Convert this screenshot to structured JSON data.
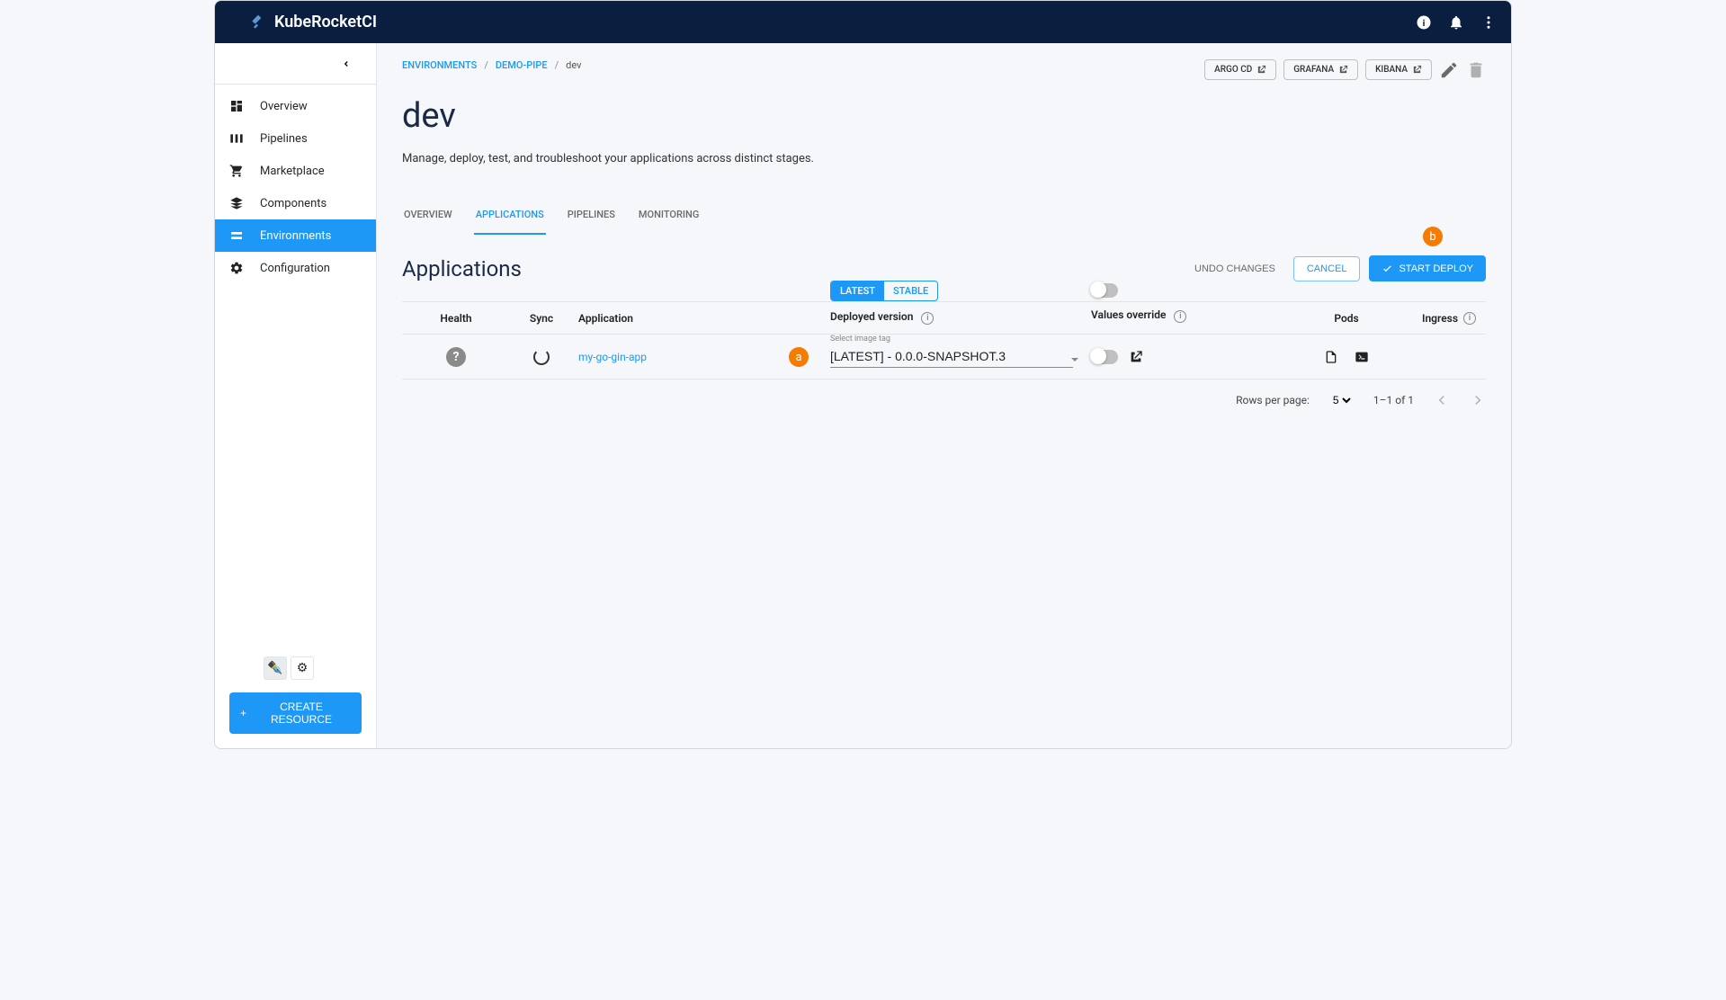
{
  "brand": "KubeRocketCI",
  "sidebar": {
    "items": [
      {
        "label": "Overview"
      },
      {
        "label": "Pipelines"
      },
      {
        "label": "Marketplace"
      },
      {
        "label": "Components"
      },
      {
        "label": "Environments"
      },
      {
        "label": "Configuration"
      }
    ],
    "create": "CREATE RESOURCE"
  },
  "breadcrumb": {
    "l0": "ENVIRONMENTS",
    "l1": "DEMO-PIPE",
    "l2": "dev"
  },
  "chips": {
    "argo": "ARGO CD",
    "grafana": "GRAFANA",
    "kibana": "KIBANA"
  },
  "page": {
    "title": "dev",
    "desc": "Manage, deploy, test, and troubleshoot your applications across distinct stages."
  },
  "tabs": {
    "overview": "OVERVIEW",
    "apps": "APPLICATIONS",
    "pipelines": "PIPELINES",
    "monitoring": "MONITORING"
  },
  "section": {
    "title": "Applications",
    "undo": "UNDO CHANGES",
    "cancel": "CANCEL",
    "deploy": "START DEPLOY"
  },
  "seg": {
    "latest": "LATEST",
    "stable": "STABLE"
  },
  "columns": {
    "health": "Health",
    "sync": "Sync",
    "app": "Application",
    "dv": "Deployed version",
    "vo": "Values override",
    "pods": "Pods",
    "ingress": "Ingress"
  },
  "row": {
    "app": "my-go-gin-app",
    "img_label": "Select image tag",
    "img_value": "[LATEST] - 0.0.0-SNAPSHOT.3"
  },
  "markers": {
    "a": "a",
    "b": "b"
  },
  "pager": {
    "rows_lbl": "Rows per page:",
    "rows_val": "5",
    "range": "1–1 of 1"
  }
}
